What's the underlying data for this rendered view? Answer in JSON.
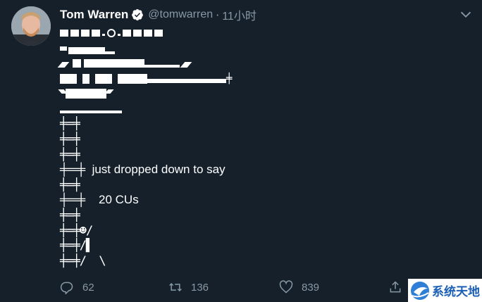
{
  "tweet": {
    "author_name": "Tom Warren",
    "handle": "@tomwarren",
    "separator": "·",
    "time": "11小时",
    "lines": {
      "l9": "╪═╪  just dropped down to say",
      "l11": "╪═╪    20 CUs",
      "l7": "╪═╪",
      "l8": "╪═╪",
      "l6": "╪═╪",
      "l10": "╪═╪",
      "l12": "╪═╪",
      "l13": "╪═╪☻/",
      "l14": "╪═╪/▌",
      "l15": "╪═╪/  \\"
    }
  },
  "actions": {
    "replies": "62",
    "retweets": "136",
    "likes": "839"
  },
  "watermark": {
    "text": "系统天地"
  },
  "icons": {
    "verified": "verified-badge-icon",
    "menu": "chevron-down-icon",
    "reply": "reply-icon",
    "retweet": "retweet-icon",
    "like": "heart-icon",
    "share": "share-icon"
  }
}
